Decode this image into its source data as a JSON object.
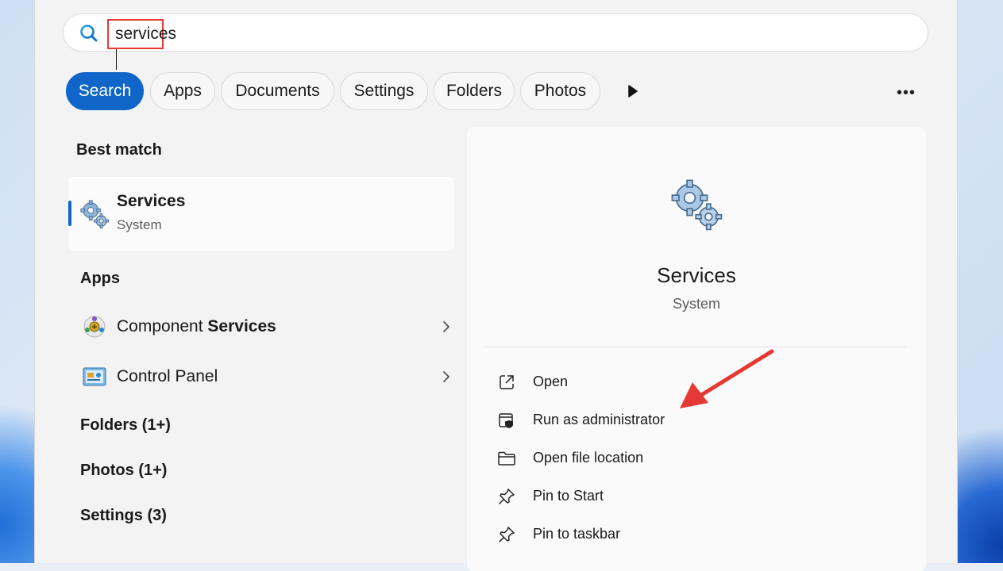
{
  "search": {
    "query": "services"
  },
  "filters": [
    {
      "label": "Search",
      "active": true
    },
    {
      "label": "Apps",
      "active": false
    },
    {
      "label": "Documents",
      "active": false
    },
    {
      "label": "Settings",
      "active": false
    },
    {
      "label": "Folders",
      "active": false
    },
    {
      "label": "Photos",
      "active": false
    }
  ],
  "results": {
    "best_match_heading": "Best match",
    "best_match": {
      "title": "Services",
      "subtitle": "System",
      "icon": "services-gears-icon"
    },
    "apps_heading": "Apps",
    "apps": [
      {
        "label_prefix": "Component ",
        "label_bold": "Services",
        "icon": "component-services-icon"
      },
      {
        "label": "Control Panel",
        "icon": "control-panel-icon"
      }
    ],
    "folders_heading": "Folders (1+)",
    "photos_heading": "Photos (1+)",
    "settings_heading": "Settings (3)"
  },
  "preview": {
    "title": "Services",
    "subtitle": "System",
    "actions": [
      {
        "label": "Open",
        "icon": "open-external-icon"
      },
      {
        "label": "Run as administrator",
        "icon": "run-as-admin-shield-icon"
      },
      {
        "label": "Open file location",
        "icon": "folder-icon"
      },
      {
        "label": "Pin to Start",
        "icon": "pin-icon"
      },
      {
        "label": "Pin to taskbar",
        "icon": "pin-icon"
      }
    ]
  },
  "colors": {
    "accent": "#1066c8",
    "highlight_box": "#e53935",
    "annotation_arrow": "#e53935"
  }
}
